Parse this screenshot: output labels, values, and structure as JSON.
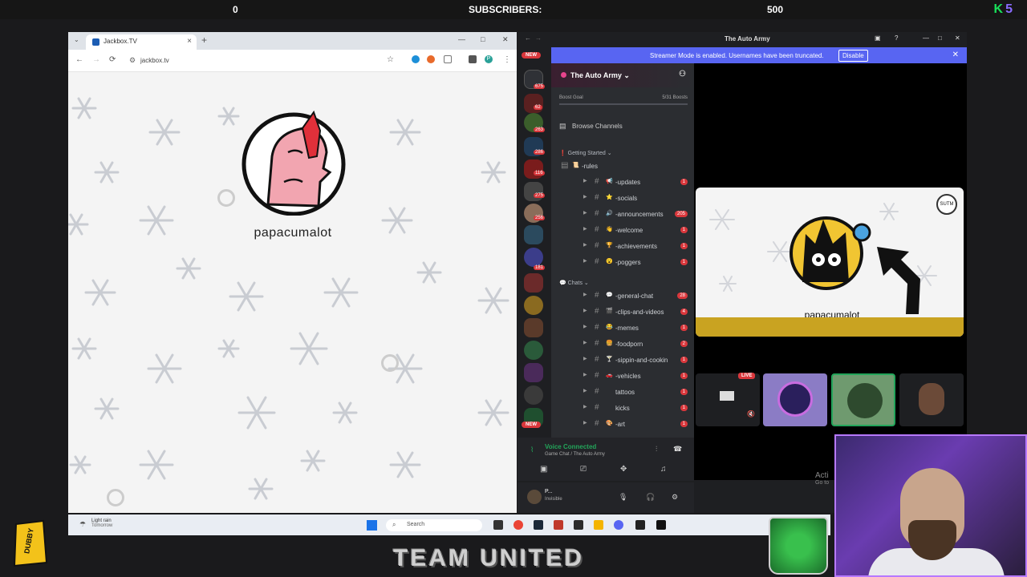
{
  "overlay": {
    "left_count": "0",
    "subscribers_label": "SUBSCRIBERS:",
    "goal": "500",
    "brand_k": "K",
    "brand_num": "5",
    "team_text": "TEAM UNITED",
    "sponsor": "DUBBY",
    "activate_line1": "Acti",
    "activate_line2": "Go to"
  },
  "browser": {
    "tab_title": "Jackbox.TV",
    "tab_close": "×",
    "new_tab": "+",
    "minimize": "—",
    "maximize": "□",
    "close": "✕",
    "back": "←",
    "forward": "→",
    "reload": "⟳",
    "url": "jackbox.tv",
    "star": "☆",
    "menu": "⋮",
    "profile": "P",
    "player_name": "papacumalot"
  },
  "discord": {
    "window_title": "The Auto Army",
    "streamer_banner": "Streamer Mode is enabled. Usernames have been truncated.",
    "disable_label": "Disable",
    "server_name": "The Auto Army",
    "boost_label": "Boost Goal",
    "boost_value": "5/31 Boosts",
    "browse_channels": "Browse Channels",
    "category_getting_started": "Getting Started",
    "category_chats": "Chats",
    "rules_channel": "-rules",
    "channels_getting_started": [
      {
        "name": "-updates",
        "emoji": "📢",
        "badge": "1"
      },
      {
        "name": "-socials",
        "emoji": "⭐",
        "badge": ""
      },
      {
        "name": "-announcements",
        "emoji": "🔊",
        "badge": "205"
      },
      {
        "name": "-welcome",
        "emoji": "👋",
        "badge": "1"
      },
      {
        "name": "-achievements",
        "emoji": "🏆",
        "badge": "1"
      },
      {
        "name": "-poggers",
        "emoji": "😮",
        "badge": "1"
      }
    ],
    "channels_chats": [
      {
        "name": "-general-chat",
        "emoji": "💬",
        "badge": "28"
      },
      {
        "name": "-clips-and-videos",
        "emoji": "🎬",
        "badge": "4"
      },
      {
        "name": "-memes",
        "emoji": "😂",
        "badge": "1"
      },
      {
        "name": "-foodporn",
        "emoji": "🍔",
        "badge": "2"
      },
      {
        "name": "-sippin-and-cookin",
        "emoji": "🍸",
        "badge": "1"
      },
      {
        "name": "-vehicles",
        "emoji": "🚗",
        "badge": "1"
      },
      {
        "name": "tattoos",
        "emoji": "",
        "badge": "1"
      },
      {
        "name": "kicks",
        "emoji": "",
        "badge": "1"
      },
      {
        "name": "-art",
        "emoji": "🎨",
        "badge": "1"
      }
    ],
    "server_badges": [
      "675",
      "62",
      "263",
      "286",
      "116",
      "275",
      "256",
      "181"
    ],
    "new_label": "NEW",
    "voice_status": "Voice Connected",
    "voice_channel": "Game Chat / The Auto Army",
    "user_name": "P...",
    "user_status": "Invisible",
    "stream_player_name": "papacumalot",
    "live_label": "LIVE"
  },
  "taskbar": {
    "weather_title": "Light rain",
    "weather_sub": "Tomorrow",
    "search_placeholder": "Search"
  },
  "colors": {
    "discord_blurple": "#5865f2",
    "discord_red": "#da373c",
    "voice_green": "#23a55a",
    "jackbox_pink": "#f2a5b0"
  }
}
